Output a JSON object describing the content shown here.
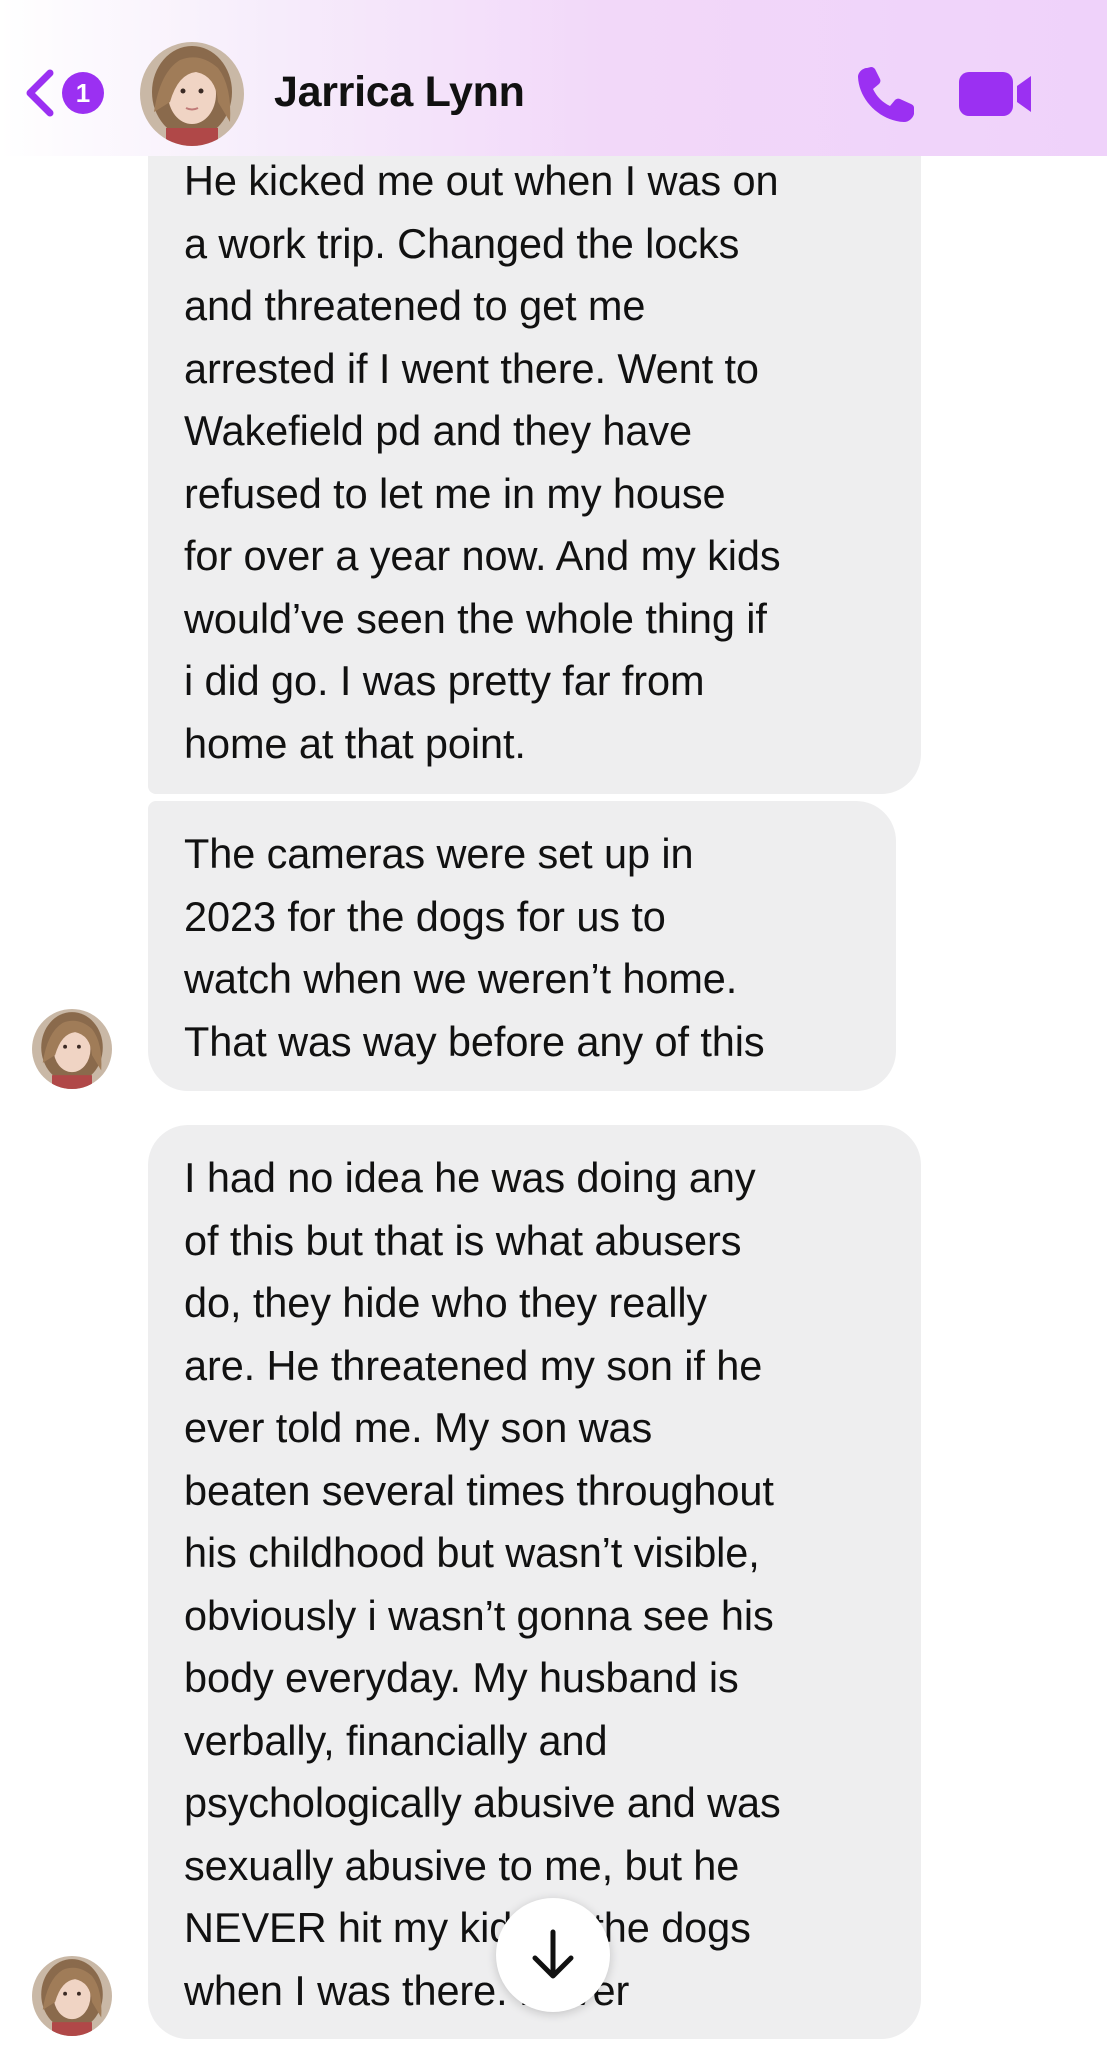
{
  "colors": {
    "accent": "#9b30f2",
    "bubble_background": "#eeeeef",
    "text": "#111111"
  },
  "header": {
    "back_icon": "chevron-left-icon",
    "unread_count": "1",
    "contact_name": "Jarrica Lynn",
    "call_icon": "phone-icon",
    "video_icon": "video-camera-icon"
  },
  "messages": [
    {
      "sender": "Jarrica Lynn",
      "text": "He kicked me out when I was on\na work trip. Changed the locks\nand threatened to get me\narrested if I went there. Went to\nWakefield pd and they have\nrefused to let me in my house\nfor over a year now. And my kids\nwould’ve seen the whole thing if\ni did go. I was pretty far from\nhome at that point."
    },
    {
      "sender": "Jarrica Lynn",
      "text": "The cameras were set up in\n2023 for the dogs for us to\nwatch when we weren’t home.\nThat was way before any of this"
    },
    {
      "sender": "Jarrica Lynn",
      "text": "I had no idea he was doing any\nof this but that is what abusers\ndo, they hide who they really\nare. He threatened my son if he\never told me. My son was\nbeaten several times throughout\nhis childhood but wasn’t visible,\nobviously i wasn’t gonna see his\nbody everyday. My husband is\nverbally, financially and\npsychologically abusive and was\nsexually abusive to me, but he\nNEVER hit my kids or the dogs\nwhen I was there. Never"
    }
  ],
  "scroll_down_icon": "arrow-down-icon"
}
